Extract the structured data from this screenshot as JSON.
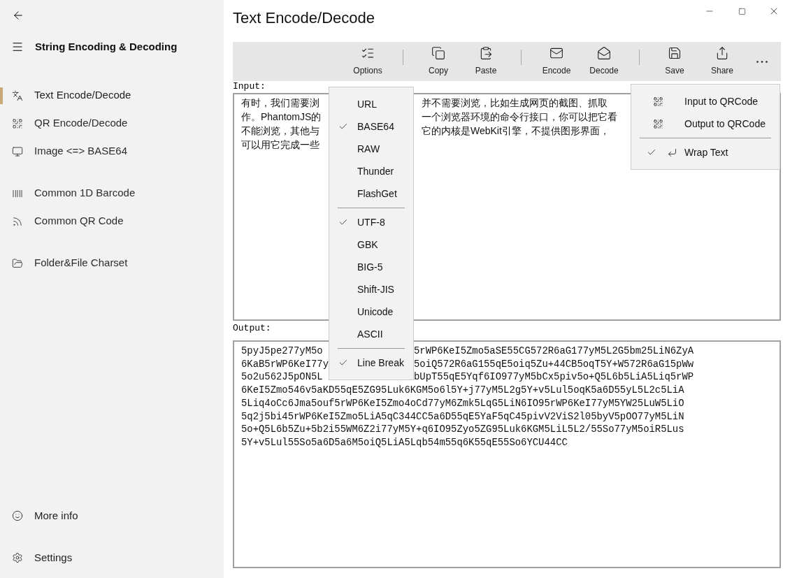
{
  "window": {
    "title": "Text Encode/Decode"
  },
  "sidebar": {
    "app_title": "String Encoding & Decoding",
    "items": [
      {
        "label": "Text Encode/Decode",
        "selected": true
      },
      {
        "label": "QR Encode/Decode",
        "selected": false
      },
      {
        "label": "Image <=> BASE64",
        "selected": false
      },
      {
        "label": "Common 1D Barcode",
        "selected": false
      },
      {
        "label": "Common QR Code",
        "selected": false
      },
      {
        "label": "Folder&File Charset",
        "selected": false
      }
    ],
    "footer": [
      {
        "label": "More info"
      },
      {
        "label": "Settings"
      }
    ]
  },
  "toolbar": [
    {
      "kind": "button",
      "label": "Options"
    },
    {
      "kind": "separator"
    },
    {
      "kind": "button",
      "label": "Copy"
    },
    {
      "kind": "button",
      "label": "Paste"
    },
    {
      "kind": "separator"
    },
    {
      "kind": "button",
      "label": "Encode"
    },
    {
      "kind": "button",
      "label": "Decode"
    },
    {
      "kind": "separator"
    },
    {
      "kind": "button",
      "label": "Save"
    },
    {
      "kind": "button",
      "label": "Share"
    },
    {
      "kind": "more"
    }
  ],
  "input": {
    "label": "Input:",
    "lines": [
      {
        "left": "有时，我们需要浏",
        "right": "并不需要浏览，比如生成网页的截图、抓取"
      },
      {
        "left": "作。PhantomJS的",
        "right": "一个浏览器环境的命令行接口，你可以把它看"
      },
      {
        "left": "不能浏览，其他与",
        "right": "它的内核是WebKit引擎，不提供图形界面，"
      },
      {
        "left": "可以用它完成一些"
      }
    ]
  },
  "output": {
    "label": "Output:",
    "lines": [
      {
        "left": "5pyJ5pe277yM5o",
        "right": "5rWP6KeI5Zmo5aSE55CG572R6aG177yM5L2G5bm25LiN6ZyA"
      },
      {
        "left": "6KaB5rWP6KeI77y",
        "right": "5oiQ572R6aG155qE5oiq5Zu+44CB5oqT5Y+W572R6aG15pWw"
      },
      {
        "left": "5o2u562J5pON5L",
        "right": "bUpT55qE5Yqf6IO977yM5bCx5piv5o+Q5L6b5LiA5Liq5rWP"
      },
      {
        "full": "6KeI5Zmo546v5aKD55qE5ZG95Luk6KGM5o6l5Y+j77yM5L2g5Y+v5Lul5oqK5a6D55yL5L2c5LiA"
      },
      {
        "full": "5Liq4oCc6Jma5ouf5rWP6KeI5Zmo4oCd77yM6Zmk5LqG5LiN6IO95rWP6KeI77yM5YW25LuW5LiO"
      },
      {
        "full": "5q2j5bi45rWP6KeI5Zmo5LiA5qC344CC5a6D55qE5YaF5qC45pivV2ViS2l05byV5pOO77yM5LiN"
      },
      {
        "full": "5o+Q5L6b5Zu+5b2i55WM6Z2i77yM5Y+q6IO95Zyo5ZG95Luk6KGM5LiL5L2/55So77yM5oiR5Lus"
      },
      {
        "full": "5Y+v5Lul55So5a6D5a6M5oiQ5LiA5Lqb54m55q6K55qE55So6YCU44CC"
      }
    ]
  },
  "options_menu": [
    {
      "kind": "item",
      "label": "URL",
      "checked": false
    },
    {
      "kind": "item",
      "label": "BASE64",
      "checked": true
    },
    {
      "kind": "item",
      "label": "RAW",
      "checked": false
    },
    {
      "kind": "item",
      "label": "Thunder",
      "checked": false
    },
    {
      "kind": "item",
      "label": "FlashGet",
      "checked": false
    },
    {
      "kind": "separator"
    },
    {
      "kind": "item",
      "label": "UTF-8",
      "checked": true
    },
    {
      "kind": "item",
      "label": "GBK",
      "checked": false
    },
    {
      "kind": "item",
      "label": "BIG-5",
      "checked": false
    },
    {
      "kind": "item",
      "label": "Shift-JIS",
      "checked": false
    },
    {
      "kind": "item",
      "label": "Unicode",
      "checked": false
    },
    {
      "kind": "item",
      "label": "ASCII",
      "checked": false
    },
    {
      "kind": "separator"
    },
    {
      "kind": "item",
      "label": "Line Break",
      "checked": true
    }
  ],
  "more_menu": [
    {
      "kind": "item",
      "label": "Input to QRCode"
    },
    {
      "kind": "item",
      "label": "Output to QRCode"
    },
    {
      "kind": "separator"
    },
    {
      "kind": "toggle",
      "label": "Wrap Text",
      "checked": true
    }
  ]
}
